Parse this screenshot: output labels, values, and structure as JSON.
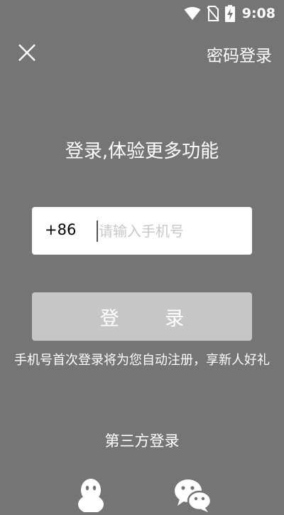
{
  "status_bar": {
    "time": "9:08",
    "icons": [
      "wifi-icon",
      "no-sim-icon",
      "battery-charging-icon"
    ]
  },
  "header": {
    "close_icon": "close-icon",
    "password_login_label": "密码登录"
  },
  "headline": "登录,体验更多功能",
  "phone_input": {
    "country_code": "+86",
    "placeholder": "请输入手机号",
    "value": ""
  },
  "login_button_label": "登 录",
  "notice": "手机号首次登录将为您自动注册，享新人好礼",
  "third_party": {
    "title": "第三方登录",
    "providers": [
      "qq-icon",
      "wechat-icon"
    ]
  },
  "colors": {
    "background": "#757575",
    "input_background": "#ffffff",
    "button_background": "#c6c6c6",
    "text": "#ffffff"
  }
}
